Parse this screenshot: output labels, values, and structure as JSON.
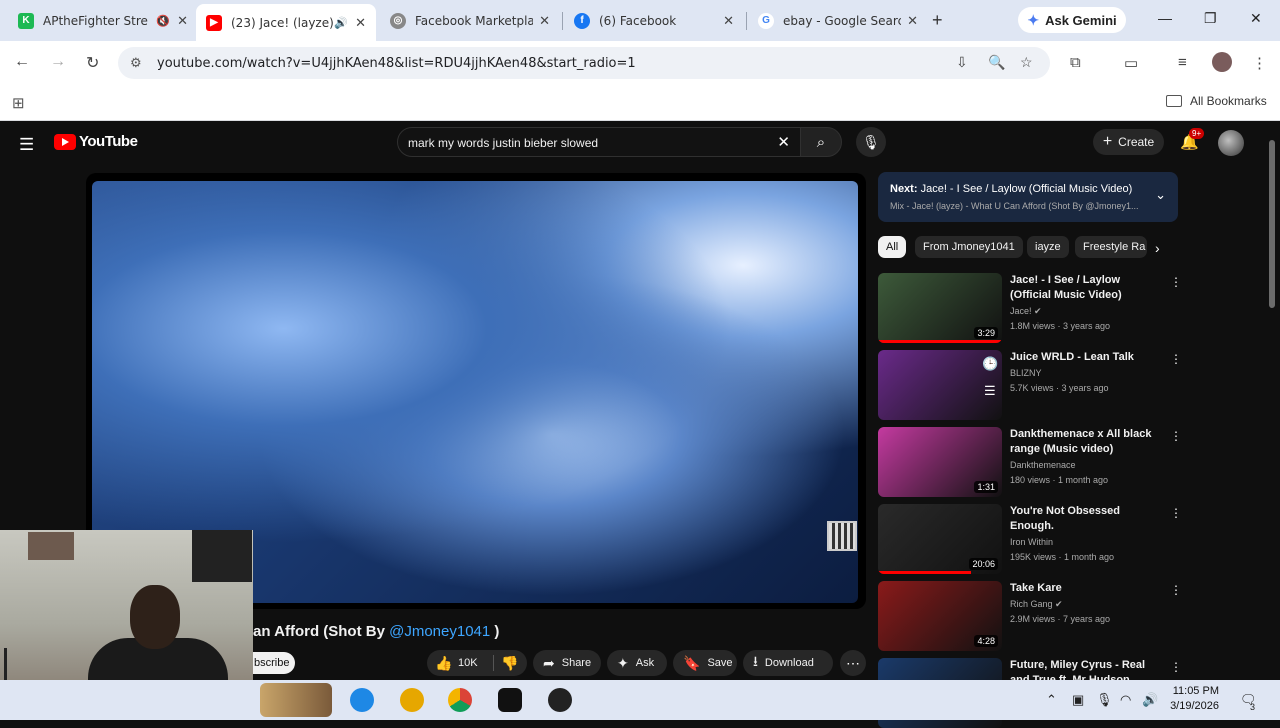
{
  "browser": {
    "tabs": [
      {
        "title": "APtheFighter Stre",
        "favicon_color": "#1db954"
      },
      {
        "title": "(23) Jace! (layze)",
        "favicon_color": "#ff0000"
      },
      {
        "title": "Facebook Marketplac",
        "favicon_color": "#888888"
      },
      {
        "title": "(6) Facebook",
        "favicon_color": "#1877f2"
      },
      {
        "title": "ebay - Google Searc",
        "favicon_color": "#4285f4"
      }
    ],
    "gemini_label": "Ask Gemini",
    "url": "youtube.com/watch?v=U4jjhKAen48&list=RDU4jjhKAen48&start_radio=1",
    "bookmarks_label": "All Bookmarks"
  },
  "youtube": {
    "logo_text": "YouTube",
    "search_query": "mark my words justin bieber slowed",
    "create_label": "Create",
    "notif_badge": "9+",
    "video": {
      "title_visible": "an Afford (Shot By ",
      "title_link": "@Jmoney1041",
      "title_end": " )",
      "subscribe_label": "bscribe",
      "likes": "10K",
      "share_label": "Share",
      "ask_label": "Ask",
      "save_label": "Save",
      "download_label": "Download"
    },
    "up_next": {
      "prefix": "Next:",
      "title": "Jace! - I See / Laylow (Official Music Video)",
      "subtitle": "Mix - Jace! (layze) - What U Can Afford (Shot By @Jmoney1..."
    },
    "chips": [
      "All",
      "From Jmoney1041",
      "iayze",
      "Freestyle Ra"
    ],
    "recommendations": [
      {
        "title": "Jace! - I See / Laylow (Official Music Video)",
        "channel": "Jace!",
        "verified": true,
        "meta": "1.8M views · 3 years ago",
        "duration": "3:29",
        "progress": 1.0,
        "thumb": "#3d5a3a"
      },
      {
        "title": "Juice WRLD - Lean Talk",
        "channel": "BLIZNY",
        "verified": false,
        "meta": "5.7K views · 3 years ago",
        "duration": "",
        "progress": 0,
        "thumb": "#6a2a8a"
      },
      {
        "title": "Dankthemenace x All black range (Music video)",
        "channel": "Dankthemenace",
        "verified": false,
        "meta": "180 views · 1 month ago",
        "duration": "1:31",
        "progress": 0,
        "thumb": "#c43aa0"
      },
      {
        "title": "You're Not Obsessed Enough.",
        "channel": "Iron Within",
        "verified": false,
        "meta": "195K views · 1 month ago",
        "duration": "20:06",
        "progress": 0.75,
        "thumb": "#2a2a2a"
      },
      {
        "title": "Take Kare",
        "channel": "Rich Gang",
        "verified": true,
        "meta": "2.9M views · 7 years ago",
        "duration": "4:28",
        "progress": 0,
        "thumb": "#8a1a1a"
      },
      {
        "title": "Future, Miley Cyrus - Real and True ft. Mr Hudson",
        "channel": "",
        "verified": false,
        "meta": "",
        "duration": "",
        "progress": 0,
        "thumb": "#1a3a6a"
      }
    ]
  },
  "taskbar": {
    "time": "11:05 PM",
    "date": "3/19/2026",
    "notif_count": "3"
  }
}
